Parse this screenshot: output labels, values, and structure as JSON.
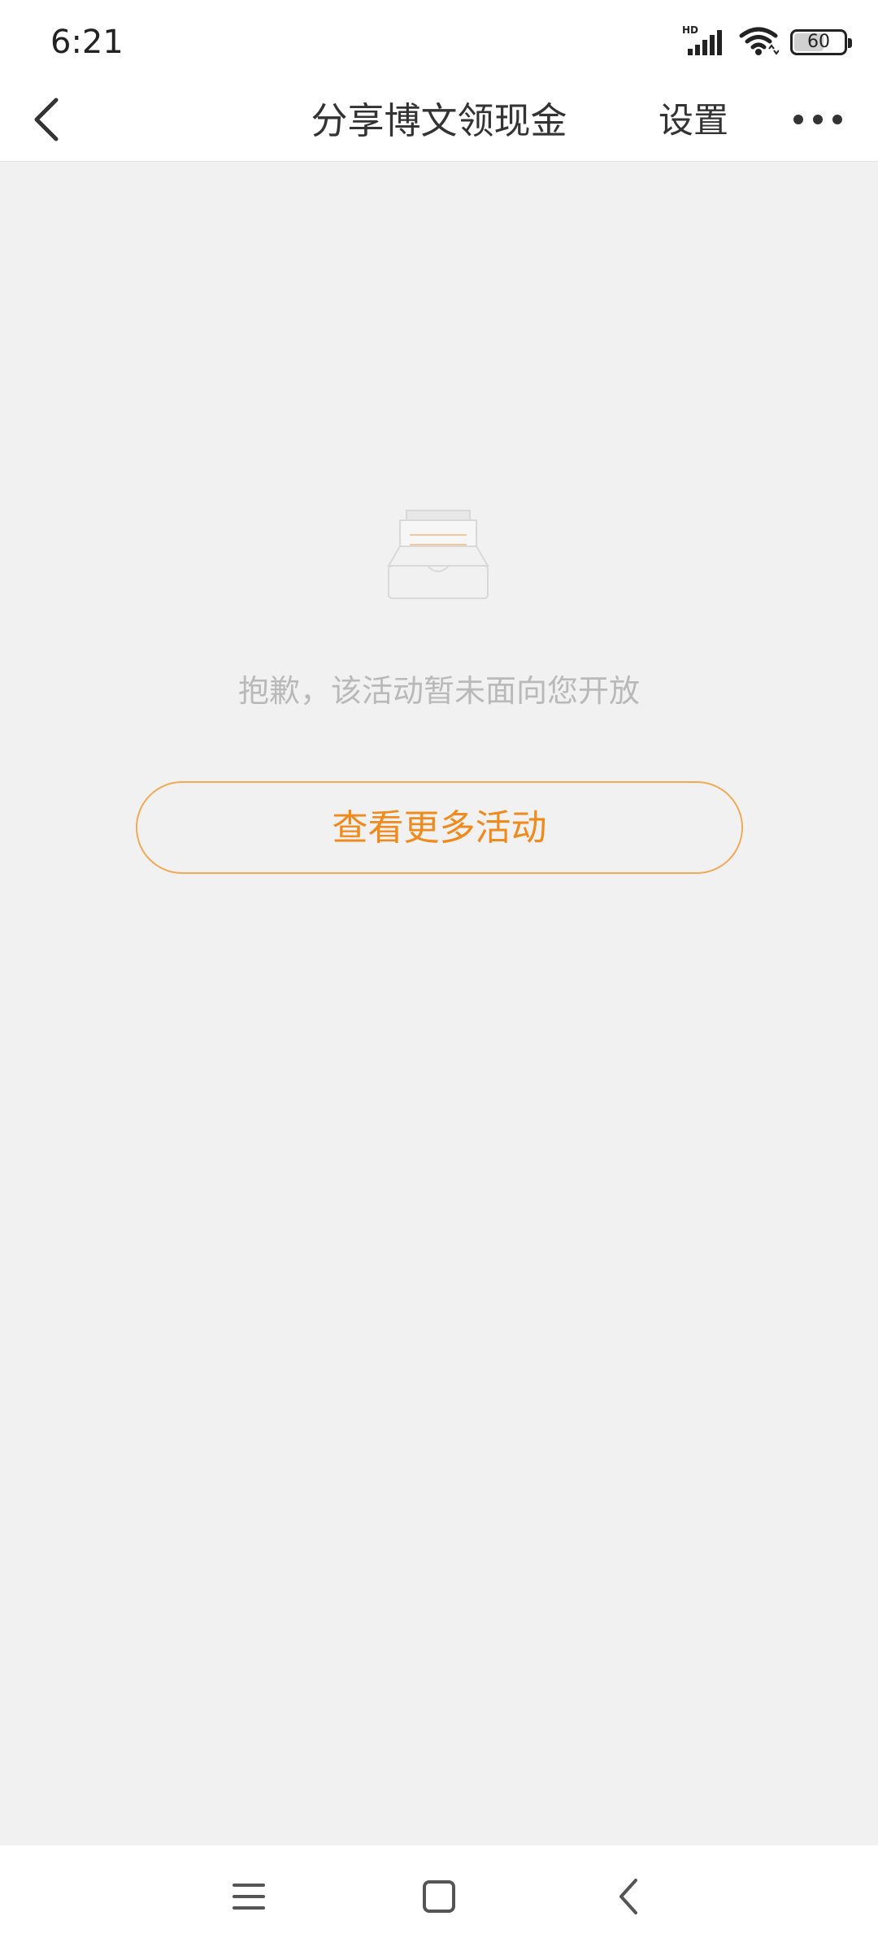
{
  "status_bar": {
    "time": "6:21",
    "network_label": "HD",
    "battery_level": "60",
    "icons": [
      "signal-icon",
      "wifi-icon",
      "battery-icon"
    ]
  },
  "nav": {
    "title": "分享博文领现金",
    "settings_label": "设置",
    "back_icon": "chevron-left-icon",
    "more_icon": "more-dots-icon"
  },
  "empty_state": {
    "icon": "empty-inbox-icon",
    "message": "抱歉，该活动暂未面向您开放",
    "button_label": "查看更多活动"
  },
  "system_nav": {
    "icons": [
      "menu-icon",
      "home-icon",
      "back-icon"
    ]
  },
  "colors": {
    "accent": "#f08a1c",
    "accent_border": "#f2a954",
    "background": "#f1f1f1",
    "message_text": "#b9b9b9"
  }
}
